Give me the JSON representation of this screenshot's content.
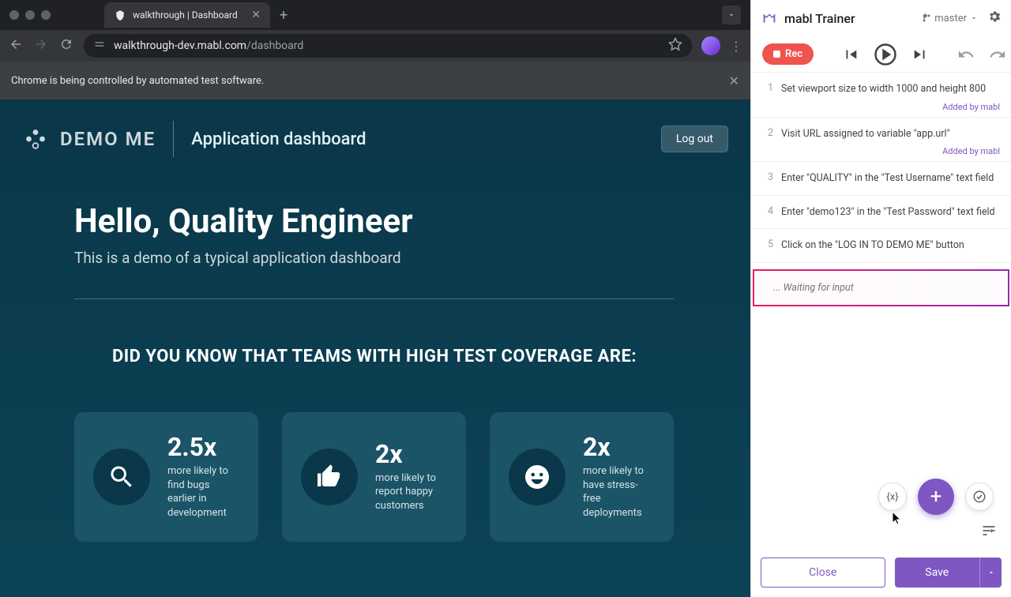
{
  "browser": {
    "tab_title": "walkthrough | Dashboard",
    "url_domain": "walkthrough-dev.mabl.com",
    "url_path": "/dashboard",
    "automation_notice": "Chrome is being controlled by automated test software."
  },
  "app": {
    "brand": "DEMO ME",
    "header_title": "Application dashboard",
    "logout_label": "Log out",
    "hero_title": "Hello, Quality Engineer",
    "hero_sub": "This is a demo of a typical application dashboard",
    "did_you_know": "DID YOU KNOW THAT TEAMS WITH HIGH TEST COVERAGE ARE:",
    "stats": [
      {
        "value": "2.5x",
        "desc": "more likely to find bugs earlier in development"
      },
      {
        "value": "2x",
        "desc": "more likely to report happy customers"
      },
      {
        "value": "2x",
        "desc": "more likely to have stress-free deployments"
      }
    ]
  },
  "trainer": {
    "title": "mabl Trainer",
    "branch": "master",
    "rec_label": "Rec",
    "steps": [
      {
        "num": "1",
        "text": "Set viewport size to width 1000 and height 800",
        "tag": "Added by mabl"
      },
      {
        "num": "2",
        "text": "Visit URL assigned to variable \"app.url\"",
        "tag": "Added by mabl"
      },
      {
        "num": "3",
        "text": "Enter \"QUALITY\" in the \"Test Username\" text field",
        "tag": ""
      },
      {
        "num": "4",
        "text": "Enter \"demo123\" in the \"Test Password\" text field",
        "tag": ""
      },
      {
        "num": "5",
        "text": "Click on the \"LOG IN TO DEMO ME\" button",
        "tag": ""
      }
    ],
    "waiting_text": "... Waiting for input",
    "var_label": "{x}",
    "close_label": "Close",
    "save_label": "Save"
  }
}
